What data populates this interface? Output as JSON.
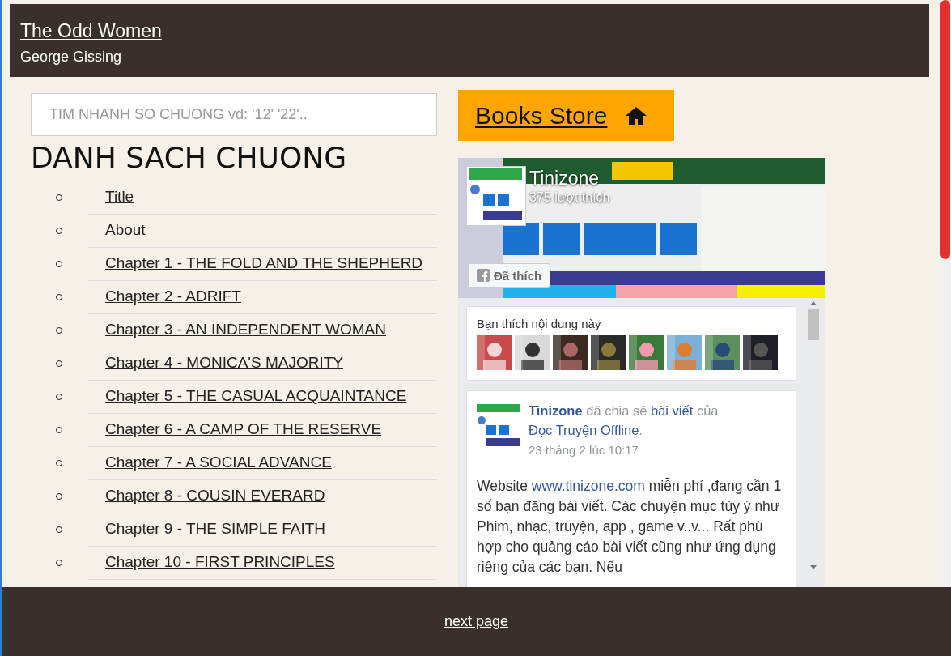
{
  "header": {
    "title": "The Odd Women",
    "author": "George Gissing"
  },
  "search": {
    "placeholder": "TIM NHANH SO CHUONG vd: '12' '22'.."
  },
  "chapters_heading": "DANH SACH CHUONG",
  "chapters": [
    "Title",
    "About",
    "Chapter 1 - THE FOLD AND THE SHEPHERD",
    "Chapter 2 - ADRIFT",
    "Chapter 3 - AN INDEPENDENT WOMAN",
    "Chapter 4 - MONICA'S MAJORITY",
    "Chapter 5 - THE CASUAL ACQUAINTANCE",
    "Chapter 6 - A CAMP OF THE RESERVE",
    "Chapter 7 - A SOCIAL ADVANCE",
    "Chapter 8 - COUSIN EVERARD",
    "Chapter 9 - THE SIMPLE FAITH",
    "Chapter 10 - FIRST PRINCIPLES"
  ],
  "store_button": "Books Store",
  "fb_widget": {
    "page_name": "Tinizone",
    "likes": "375 lượt thích",
    "like_button": "Đã thích",
    "liked": true,
    "friends_label": "Bạn thích nội dung này",
    "post": {
      "header": [
        {
          "kind": "name",
          "text": "Tinizone"
        },
        {
          "kind": "plain",
          "text": " đã chia sẻ "
        },
        {
          "kind": "link",
          "text": "bài viết"
        },
        {
          "kind": "plain",
          "text": " của "
        },
        {
          "kind": "link",
          "text": "Đọc Truyện Offline"
        },
        {
          "kind": "plain",
          "text": "."
        }
      ],
      "time": "23 tháng 2 lúc 10:17",
      "body": [
        {
          "kind": "plain",
          "text": "Website "
        },
        {
          "kind": "link",
          "text": "www.tinizone.com"
        },
        {
          "kind": "plain",
          "text": " miễn phí ,đang cần 1 số bạn đăng bài viết. Các chuyện mục tùy ý như Phim, nhạc, truyện, app , game v..v... Rất phù hợp cho quảng cáo bài viết cũng như ứng dụng riêng của các bạn. Nếu"
        }
      ]
    }
  },
  "footer": {
    "next": "next page"
  }
}
